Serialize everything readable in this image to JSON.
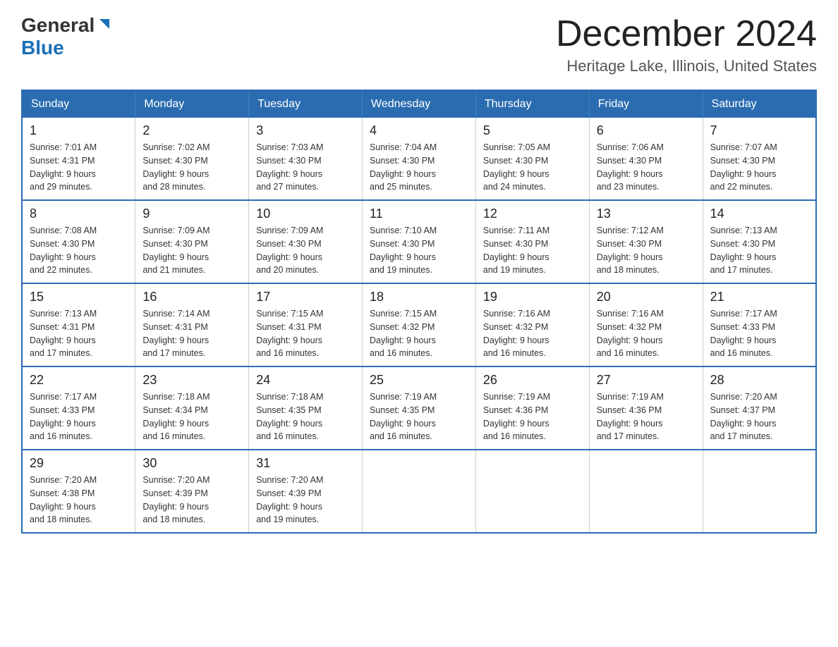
{
  "header": {
    "logo_text1": "General",
    "logo_text2": "Blue",
    "month_title": "December 2024",
    "location": "Heritage Lake, Illinois, United States"
  },
  "weekdays": [
    "Sunday",
    "Monday",
    "Tuesday",
    "Wednesday",
    "Thursday",
    "Friday",
    "Saturday"
  ],
  "weeks": [
    [
      {
        "day": "1",
        "sunrise": "7:01 AM",
        "sunset": "4:31 PM",
        "daylight": "9 hours and 29 minutes."
      },
      {
        "day": "2",
        "sunrise": "7:02 AM",
        "sunset": "4:30 PM",
        "daylight": "9 hours and 28 minutes."
      },
      {
        "day": "3",
        "sunrise": "7:03 AM",
        "sunset": "4:30 PM",
        "daylight": "9 hours and 27 minutes."
      },
      {
        "day": "4",
        "sunrise": "7:04 AM",
        "sunset": "4:30 PM",
        "daylight": "9 hours and 25 minutes."
      },
      {
        "day": "5",
        "sunrise": "7:05 AM",
        "sunset": "4:30 PM",
        "daylight": "9 hours and 24 minutes."
      },
      {
        "day": "6",
        "sunrise": "7:06 AM",
        "sunset": "4:30 PM",
        "daylight": "9 hours and 23 minutes."
      },
      {
        "day": "7",
        "sunrise": "7:07 AM",
        "sunset": "4:30 PM",
        "daylight": "9 hours and 22 minutes."
      }
    ],
    [
      {
        "day": "8",
        "sunrise": "7:08 AM",
        "sunset": "4:30 PM",
        "daylight": "9 hours and 22 minutes."
      },
      {
        "day": "9",
        "sunrise": "7:09 AM",
        "sunset": "4:30 PM",
        "daylight": "9 hours and 21 minutes."
      },
      {
        "day": "10",
        "sunrise": "7:09 AM",
        "sunset": "4:30 PM",
        "daylight": "9 hours and 20 minutes."
      },
      {
        "day": "11",
        "sunrise": "7:10 AM",
        "sunset": "4:30 PM",
        "daylight": "9 hours and 19 minutes."
      },
      {
        "day": "12",
        "sunrise": "7:11 AM",
        "sunset": "4:30 PM",
        "daylight": "9 hours and 19 minutes."
      },
      {
        "day": "13",
        "sunrise": "7:12 AM",
        "sunset": "4:30 PM",
        "daylight": "9 hours and 18 minutes."
      },
      {
        "day": "14",
        "sunrise": "7:13 AM",
        "sunset": "4:30 PM",
        "daylight": "9 hours and 17 minutes."
      }
    ],
    [
      {
        "day": "15",
        "sunrise": "7:13 AM",
        "sunset": "4:31 PM",
        "daylight": "9 hours and 17 minutes."
      },
      {
        "day": "16",
        "sunrise": "7:14 AM",
        "sunset": "4:31 PM",
        "daylight": "9 hours and 17 minutes."
      },
      {
        "day": "17",
        "sunrise": "7:15 AM",
        "sunset": "4:31 PM",
        "daylight": "9 hours and 16 minutes."
      },
      {
        "day": "18",
        "sunrise": "7:15 AM",
        "sunset": "4:32 PM",
        "daylight": "9 hours and 16 minutes."
      },
      {
        "day": "19",
        "sunrise": "7:16 AM",
        "sunset": "4:32 PM",
        "daylight": "9 hours and 16 minutes."
      },
      {
        "day": "20",
        "sunrise": "7:16 AM",
        "sunset": "4:32 PM",
        "daylight": "9 hours and 16 minutes."
      },
      {
        "day": "21",
        "sunrise": "7:17 AM",
        "sunset": "4:33 PM",
        "daylight": "9 hours and 16 minutes."
      }
    ],
    [
      {
        "day": "22",
        "sunrise": "7:17 AM",
        "sunset": "4:33 PM",
        "daylight": "9 hours and 16 minutes."
      },
      {
        "day": "23",
        "sunrise": "7:18 AM",
        "sunset": "4:34 PM",
        "daylight": "9 hours and 16 minutes."
      },
      {
        "day": "24",
        "sunrise": "7:18 AM",
        "sunset": "4:35 PM",
        "daylight": "9 hours and 16 minutes."
      },
      {
        "day": "25",
        "sunrise": "7:19 AM",
        "sunset": "4:35 PM",
        "daylight": "9 hours and 16 minutes."
      },
      {
        "day": "26",
        "sunrise": "7:19 AM",
        "sunset": "4:36 PM",
        "daylight": "9 hours and 16 minutes."
      },
      {
        "day": "27",
        "sunrise": "7:19 AM",
        "sunset": "4:36 PM",
        "daylight": "9 hours and 17 minutes."
      },
      {
        "day": "28",
        "sunrise": "7:20 AM",
        "sunset": "4:37 PM",
        "daylight": "9 hours and 17 minutes."
      }
    ],
    [
      {
        "day": "29",
        "sunrise": "7:20 AM",
        "sunset": "4:38 PM",
        "daylight": "9 hours and 18 minutes."
      },
      {
        "day": "30",
        "sunrise": "7:20 AM",
        "sunset": "4:39 PM",
        "daylight": "9 hours and 18 minutes."
      },
      {
        "day": "31",
        "sunrise": "7:20 AM",
        "sunset": "4:39 PM",
        "daylight": "9 hours and 19 minutes."
      },
      null,
      null,
      null,
      null
    ]
  ],
  "labels": {
    "sunrise": "Sunrise:",
    "sunset": "Sunset:",
    "daylight": "Daylight:"
  }
}
